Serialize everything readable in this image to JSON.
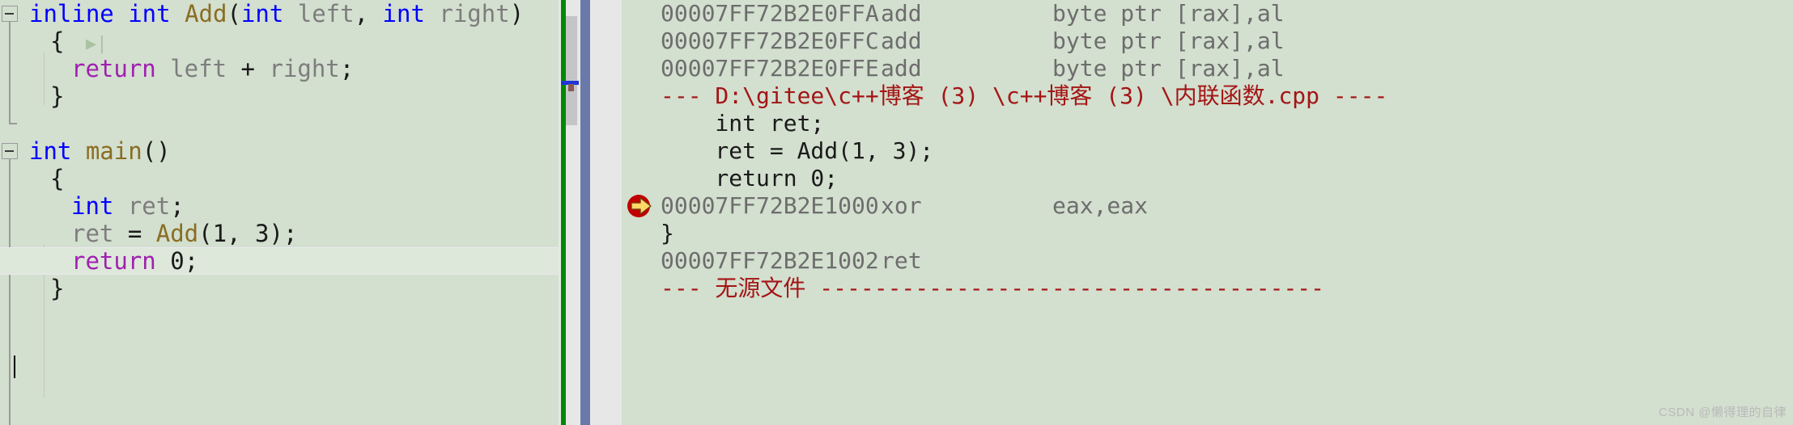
{
  "editor": {
    "name": "source-code-editor",
    "background_color": "#d3dfcf",
    "lines": [
      {
        "id": "l1",
        "indent": 0,
        "segments": [
          {
            "t": "inline ",
            "c": "kw"
          },
          {
            "t": "int ",
            "c": "kw"
          },
          {
            "t": "Add",
            "c": "fn"
          },
          {
            "t": "(",
            "c": "punct"
          },
          {
            "t": "int ",
            "c": "kw"
          },
          {
            "t": "left",
            "c": "id"
          },
          {
            "t": ", ",
            "c": "punct"
          },
          {
            "t": "int ",
            "c": "kw"
          },
          {
            "t": "right",
            "c": "id"
          },
          {
            "t": ")",
            "c": "punct"
          }
        ]
      },
      {
        "id": "l2",
        "indent": 1,
        "segments": [
          {
            "t": "{",
            "c": "punct"
          }
        ]
      },
      {
        "id": "l3",
        "indent": 2,
        "segments": [
          {
            "t": "return ",
            "c": "ret-kw"
          },
          {
            "t": "left ",
            "c": "id"
          },
          {
            "t": "+ ",
            "c": "op"
          },
          {
            "t": "right",
            "c": "id"
          },
          {
            "t": ";",
            "c": "punct"
          }
        ]
      },
      {
        "id": "l4",
        "indent": 1,
        "segments": [
          {
            "t": "}",
            "c": "punct"
          }
        ]
      },
      {
        "id": "l5",
        "indent": 0,
        "segments": []
      },
      {
        "id": "l6",
        "indent": 0,
        "segments": [
          {
            "t": "int ",
            "c": "kw"
          },
          {
            "t": "main",
            "c": "fn"
          },
          {
            "t": "()",
            "c": "punct"
          }
        ]
      },
      {
        "id": "l7",
        "indent": 1,
        "segments": [
          {
            "t": "{",
            "c": "punct"
          }
        ]
      },
      {
        "id": "l8",
        "indent": 2,
        "segments": [
          {
            "t": "int ",
            "c": "kw"
          },
          {
            "t": "ret",
            "c": "id"
          },
          {
            "t": ";",
            "c": "punct"
          }
        ]
      },
      {
        "id": "l9",
        "indent": 2,
        "segments": [
          {
            "t": "ret ",
            "c": "id"
          },
          {
            "t": "= ",
            "c": "op"
          },
          {
            "t": "Add",
            "c": "fn"
          },
          {
            "t": "(",
            "c": "punct"
          },
          {
            "t": "1",
            "c": "num"
          },
          {
            "t": ", ",
            "c": "punct"
          },
          {
            "t": "3",
            "c": "num"
          },
          {
            "t": ");",
            "c": "punct"
          }
        ]
      },
      {
        "id": "l10",
        "indent": 2,
        "current": true,
        "segments": [
          {
            "t": "return ",
            "c": "ret-kw"
          },
          {
            "t": "0",
            "c": "num"
          },
          {
            "t": ";",
            "c": "punct"
          }
        ]
      },
      {
        "id": "l11",
        "indent": 1,
        "segments": [
          {
            "t": "}",
            "c": "punct"
          }
        ]
      }
    ],
    "outlining": {
      "expand_glyph": "▶",
      "collapse_minus": "-"
    }
  },
  "divider": {
    "name": "editor-splitter",
    "green_bar_color": "#008a00",
    "scrollbar_thumb_color": "#c5c5c8",
    "splitter_color": "#6a7aa8",
    "bookmark_marker_color": "#1e35d8"
  },
  "disassembly": {
    "name": "disassembly-view",
    "lines": [
      {
        "kind": "asm",
        "address": "00007FF72B2E0FFA",
        "mnemonic": "add",
        "operands": "byte ptr [rax],al"
      },
      {
        "kind": "asm",
        "address": "00007FF72B2E0FFC",
        "mnemonic": "add",
        "operands": "byte ptr [rax],al"
      },
      {
        "kind": "asm",
        "address": "00007FF72B2E0FFE",
        "mnemonic": "add",
        "operands": "byte ptr [rax],al"
      },
      {
        "kind": "comment",
        "text": "--- D:\\gitee\\c++博客 (3) \\c++博客 (3) \\内联函数.cpp ----"
      },
      {
        "kind": "src",
        "text": "    int ret;"
      },
      {
        "kind": "src",
        "text": "    ret = Add(1, 3);"
      },
      {
        "kind": "src",
        "text": "    return 0;"
      },
      {
        "kind": "asm",
        "address": "00007FF72B2E1000",
        "mnemonic": "xor",
        "operands": "eax,eax",
        "current": true
      },
      {
        "kind": "src",
        "text": "}"
      },
      {
        "kind": "asm",
        "address": "00007FF72B2E1002",
        "mnemonic": "ret",
        "operands": ""
      },
      {
        "kind": "comment",
        "text": "--- 无源文件 -------------------------------------"
      }
    ],
    "exec_arrow": {
      "name": "current-statement-arrow",
      "fill": "#ffd966",
      "stroke": "#c00000"
    }
  },
  "watermark": {
    "text": "CSDN @懒得理的自律"
  }
}
